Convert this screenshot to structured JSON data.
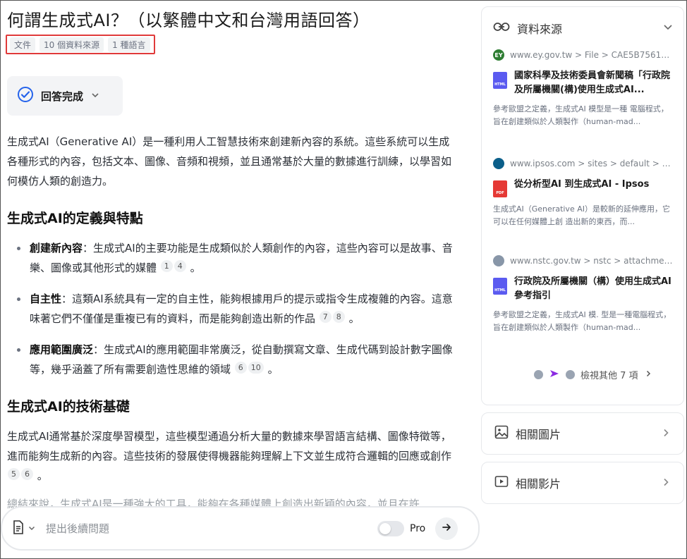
{
  "title": "何謂生成式AI？（以繁體中文和台灣用語回答）",
  "tags": [
    "文件",
    "10 個資料來源",
    "1 種語言"
  ],
  "status": {
    "label": "回答完成"
  },
  "intro": "生成式AI（Generative AI）是一種利用人工智慧技術來創建新內容的系統。這些系統可以生成各種形式的內容，包括文本、圖像、音頻和視頻，並且通常基於大量的數據進行訓練，以學習如何模仿人類的創造力。",
  "section1": {
    "heading": "生成式AI的定義與特點",
    "items": [
      {
        "bold": "創建新內容",
        "text": "：生成式AI的主要功能是生成類似於人類創作的內容，這些內容可以是故事、音樂、圖像或其他形式的媒體",
        "cites": [
          "1",
          "4"
        ],
        "end": "。"
      },
      {
        "bold": "自主性",
        "text": "：這類AI系統具有一定的自主性，能夠根據用戶的提示或指令生成複雜的內容。這意味著它們不僅僅是重複已有的資料，而是能夠創造出新的作品",
        "cites": [
          "7",
          "8"
        ],
        "end": "。"
      },
      {
        "bold": "應用範圍廣泛",
        "text": "：生成式AI的應用範圍非常廣泛，從自動撰寫文章、生成代碼到設計數字圖像等，幾乎涵蓋了所有需要創造性思維的領域",
        "cites": [
          "6",
          "10"
        ],
        "end": "。"
      }
    ]
  },
  "section2": {
    "heading": "生成式AI的技術基礎",
    "text": "生成式AI通常基於深度學習模型，這些模型通過分析大量的數據來學習語言結構、圖像特徵等，進而能夠生成新的內容。這些技術的發展使得機器能夠理解上下文並生成符合邏輯的回應或創作",
    "cites": [
      "5",
      "6"
    ],
    "end": "。"
  },
  "partial_line": "總結來說，生成式AI是一種強大的工具，能夠在各種媒體上創造出新穎的內容，並且在許",
  "input": {
    "placeholder": "提出後續問題",
    "pro_label": "Pro"
  },
  "sources_panel": {
    "heading": "資料來源",
    "sources": [
      {
        "url": "www.ey.gov.tw > File > CAE5B756153...",
        "title": "國家科學及技術委員會新聞稿「行政院及所屬機關(構)使用生成式AI...",
        "desc": "參考歐盟之定義，生成式AI 模型是一種 電腦程式，旨在創建類似於人類製作（human-mad...",
        "file_type": "HTML",
        "fav_label": "EY"
      },
      {
        "url": "www.ipsos.com > sites > default > file...",
        "title": "從分析型AI 到生成式AI - Ipsos",
        "desc": "生成式AI（Generative AI）是較新的延伸應用，它可以在任何媒體上創 造出新的東西，而...",
        "file_type": "PDF",
        "fav_label": ""
      },
      {
        "url": "www.nstc.gov.tw > nstc > attachment...",
        "title": "行政院及所屬機關（構）使用生成式AI 參考指引",
        "desc": "參考歐盟之定義，生成式AI 模. 型是一種電腦程式，旨在創建類似於人類製作（human-mad...",
        "file_type": "HTML",
        "fav_label": ""
      }
    ],
    "more_label": "檢視其他 7 項"
  },
  "related_images": "相關圖片",
  "related_videos": "相關影片",
  "colors": {
    "accent": "#2563eb",
    "html_icon": "#5b5bf0",
    "pdf_icon": "#e53935",
    "highlight_border": "#e03a3a"
  }
}
